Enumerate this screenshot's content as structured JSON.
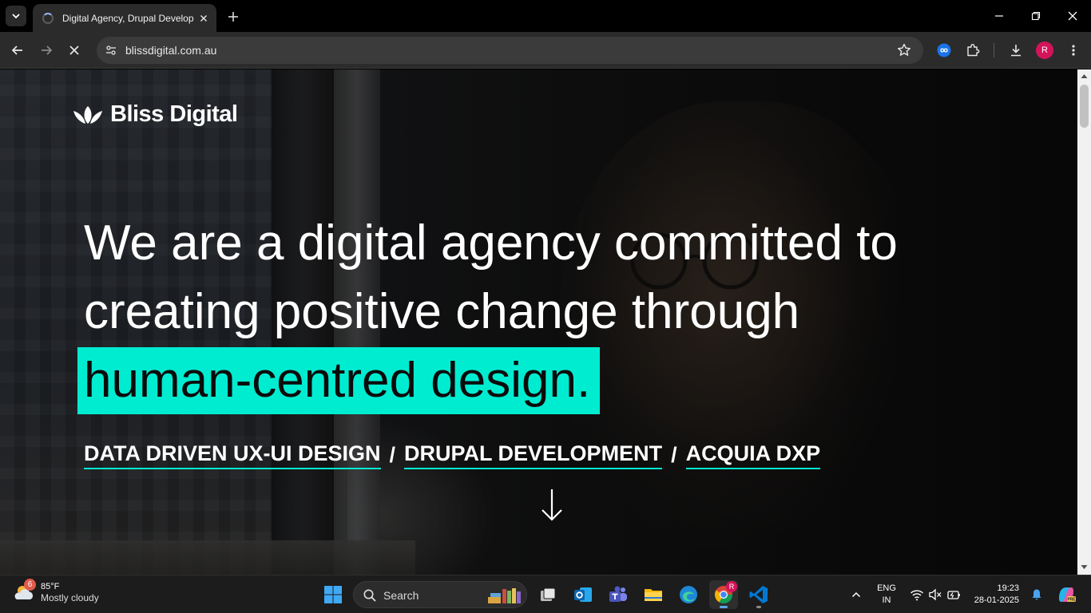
{
  "browser": {
    "tab_title": "Digital Agency, Drupal Develop",
    "url": "blissdigital.com.au",
    "profile_initial": "R"
  },
  "page": {
    "logo_text": "Bliss Digital",
    "headline_line1": "We are a digital agency committed to",
    "headline_line2": "creating positive change through",
    "headline_highlight": "human-centred design.",
    "services": [
      "DATA DRIVEN UX-UI DESIGN",
      "DRUPAL DEVELOPMENT",
      "ACQUIA DXP"
    ],
    "separator": "/",
    "accent_color": "#00ecd1"
  },
  "taskbar": {
    "weather_badge": "6",
    "weather_temp": "85°F",
    "weather_condition": "Mostly cloudy",
    "search_label": "Search",
    "chrome_badge": "R",
    "lang_line1": "ENG",
    "lang_line2": "IN",
    "time": "19:23",
    "date": "28-01-2025",
    "apps": [
      "task-view",
      "outlook",
      "teams",
      "file-explorer",
      "edge",
      "chrome",
      "vscode"
    ]
  }
}
